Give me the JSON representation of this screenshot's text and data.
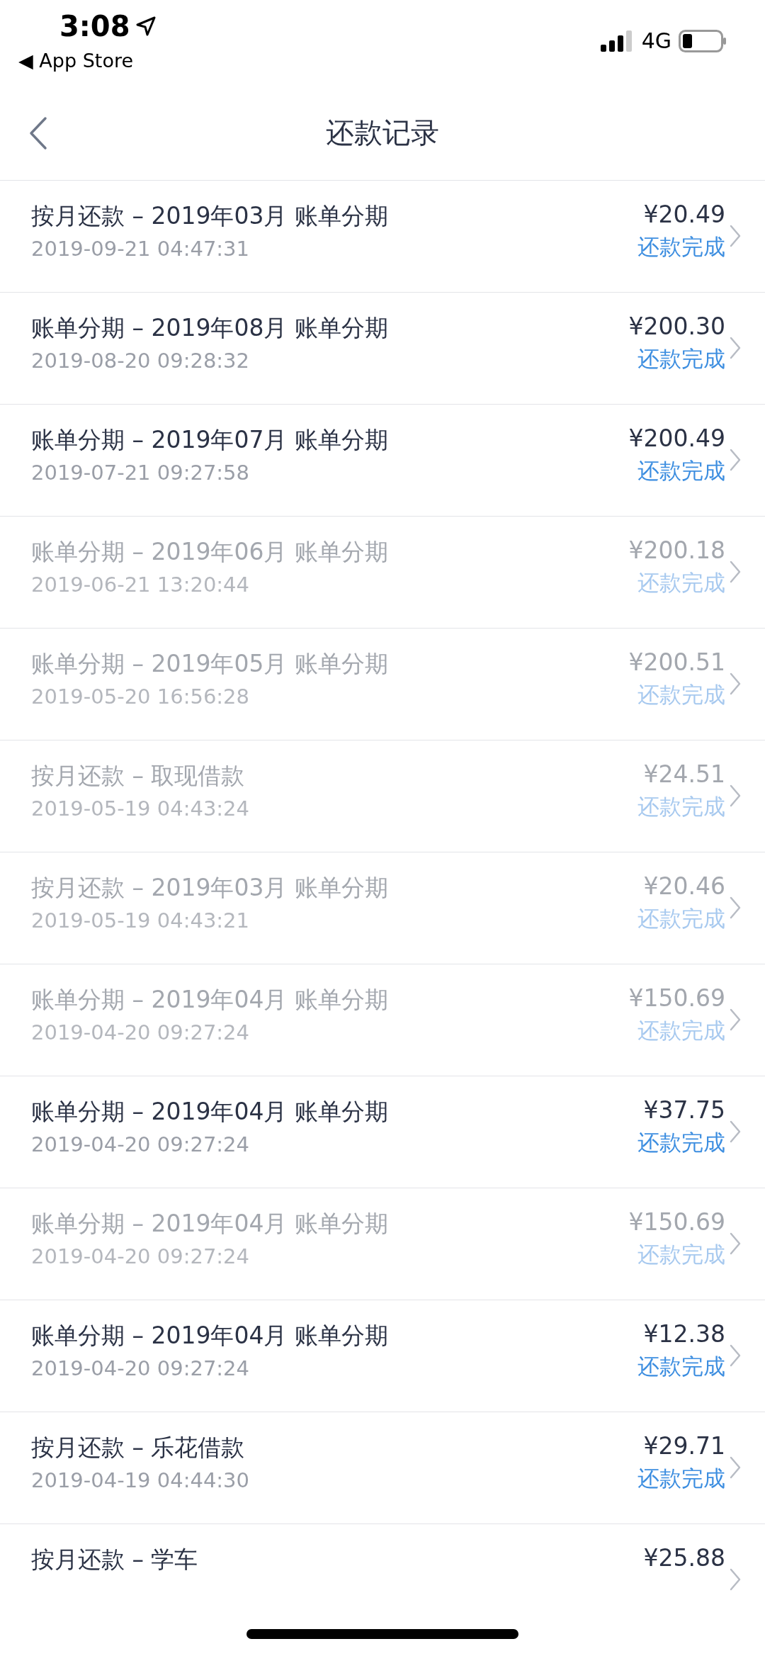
{
  "status_bar": {
    "time": "3:08",
    "back_app": "◀ App Store",
    "network": "4G"
  },
  "nav": {
    "title": "还款记录"
  },
  "records": [
    {
      "title": "按月还款 – 2019年03月 账单分期",
      "date": "2019-09-21 04:47:31",
      "amount": "¥20.49",
      "status": "还款完成",
      "dimmed": false
    },
    {
      "title": "账单分期 – 2019年08月 账单分期",
      "date": "2019-08-20 09:28:32",
      "amount": "¥200.30",
      "status": "还款完成",
      "dimmed": false
    },
    {
      "title": "账单分期 – 2019年07月 账单分期",
      "date": "2019-07-21 09:27:58",
      "amount": "¥200.49",
      "status": "还款完成",
      "dimmed": false
    },
    {
      "title": "账单分期 – 2019年06月 账单分期",
      "date": "2019-06-21 13:20:44",
      "amount": "¥200.18",
      "status": "还款完成",
      "dimmed": true
    },
    {
      "title": "账单分期 – 2019年05月 账单分期",
      "date": "2019-05-20 16:56:28",
      "amount": "¥200.51",
      "status": "还款完成",
      "dimmed": true
    },
    {
      "title": "按月还款 – 取现借款",
      "date": "2019-05-19 04:43:24",
      "amount": "¥24.51",
      "status": "还款完成",
      "dimmed": true
    },
    {
      "title": "按月还款 – 2019年03月 账单分期",
      "date": "2019-05-19 04:43:21",
      "amount": "¥20.46",
      "status": "还款完成",
      "dimmed": true
    },
    {
      "title": "账单分期 – 2019年04月 账单分期",
      "date": "2019-04-20 09:27:24",
      "amount": "¥150.69",
      "status": "还款完成",
      "dimmed": true
    },
    {
      "title": "账单分期 – 2019年04月 账单分期",
      "date": "2019-04-20 09:27:24",
      "amount": "¥37.75",
      "status": "还款完成",
      "dimmed": false
    },
    {
      "title": "账单分期 – 2019年04月 账单分期",
      "date": "2019-04-20 09:27:24",
      "amount": "¥150.69",
      "status": "还款完成",
      "dimmed": true
    },
    {
      "title": "账单分期 – 2019年04月 账单分期",
      "date": "2019-04-20 09:27:24",
      "amount": "¥12.38",
      "status": "还款完成",
      "dimmed": false
    },
    {
      "title": "按月还款 – 乐花借款",
      "date": "2019-04-19 04:44:30",
      "amount": "¥29.71",
      "status": "还款完成",
      "dimmed": false
    },
    {
      "title": "按月还款 – 学车",
      "amount": "¥25.88",
      "dimmed": false
    }
  ]
}
